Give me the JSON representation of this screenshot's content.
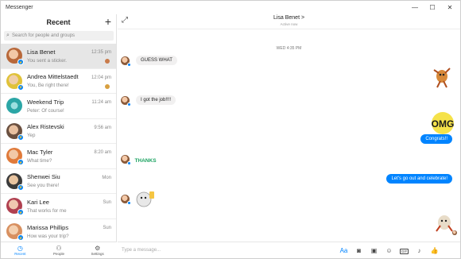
{
  "window": {
    "title": "Messenger",
    "min": "—",
    "max": "☐",
    "close": "✕"
  },
  "left": {
    "title": "Recent",
    "new_label": "+",
    "search_placeholder": "Search for people and groups",
    "conversations": [
      {
        "name": "Lisa Benet",
        "preview": "You sent a sticker.",
        "time": "12:35 pm",
        "avatar_color": "#c97b4a"
      },
      {
        "name": "Andrea Mittelstaedt",
        "preview": "You, Be right there!",
        "time": "12:04 pm",
        "avatar_color": "#e0c23a"
      },
      {
        "name": "Weekend Trip",
        "preview": "Peter: Of course!",
        "time": "11:24 am",
        "avatar_color": "#2ba6a6"
      },
      {
        "name": "Alex Ristevski",
        "preview": "Yep",
        "time": "9:56 am",
        "avatar_color": "#8a6a55"
      },
      {
        "name": "Mac Tyler",
        "preview": "What time?",
        "time": "8:20 am",
        "avatar_color": "#e07a3a"
      },
      {
        "name": "Shenwei Siu",
        "preview": "See you there!",
        "time": "Mon",
        "avatar_color": "#3b3b3b"
      },
      {
        "name": "Kari Lee",
        "preview": "That works for me",
        "time": "Sun",
        "avatar_color": "#b04050"
      },
      {
        "name": "Marissa Phillips",
        "preview": "How was your trip?",
        "time": "Sun",
        "avatar_color": "#d89060"
      }
    ],
    "nav": [
      {
        "label": "Recent",
        "icon": "clock-icon"
      },
      {
        "label": "People",
        "icon": "people-icon"
      },
      {
        "label": "Settings",
        "icon": "gear-icon"
      }
    ]
  },
  "chat": {
    "contact_name": "Lisa Benet >",
    "status": "Active now",
    "timestamp": "WED 4:35 PM",
    "messages": [
      {
        "text": "GUESS WHAT",
        "side": "in"
      },
      {
        "text": "I got the job!!!!",
        "side": "in"
      },
      {
        "text": "Congrats!!",
        "side": "out"
      },
      {
        "text": "Let's go out and celebrate!",
        "side": "out"
      }
    ],
    "stickers": {
      "omg": "OMG",
      "thanks": "THANKS"
    },
    "composer_placeholder": "Type a message...",
    "composer_icons": {
      "aa": "Aa",
      "gif": "GIF"
    }
  },
  "colors": {
    "accent": "#0084ff",
    "bubble_in": "#f1f0f0",
    "selected_row": "#e6e6e6"
  }
}
